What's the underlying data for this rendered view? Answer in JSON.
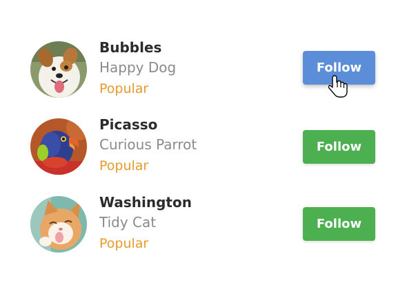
{
  "accent_colors": {
    "follow_active": "#5b8dd9",
    "follow": "#4caf50",
    "popular": "#e99a2c"
  },
  "users": [
    {
      "name": "Bubbles",
      "subtitle": "Happy Dog",
      "badge": "Popular",
      "avatar_icon": "dog-avatar",
      "button_label": "Follow",
      "button_state": "hover"
    },
    {
      "name": "Picasso",
      "subtitle": "Curious Parrot",
      "badge": "Popular",
      "avatar_icon": "parrot-avatar",
      "button_label": "Follow",
      "button_state": "default"
    },
    {
      "name": "Washington",
      "subtitle": "Tidy Cat",
      "badge": "Popular",
      "avatar_icon": "cat-avatar",
      "button_label": "Follow",
      "button_state": "default"
    }
  ],
  "cursor": "hand-pointer-icon"
}
